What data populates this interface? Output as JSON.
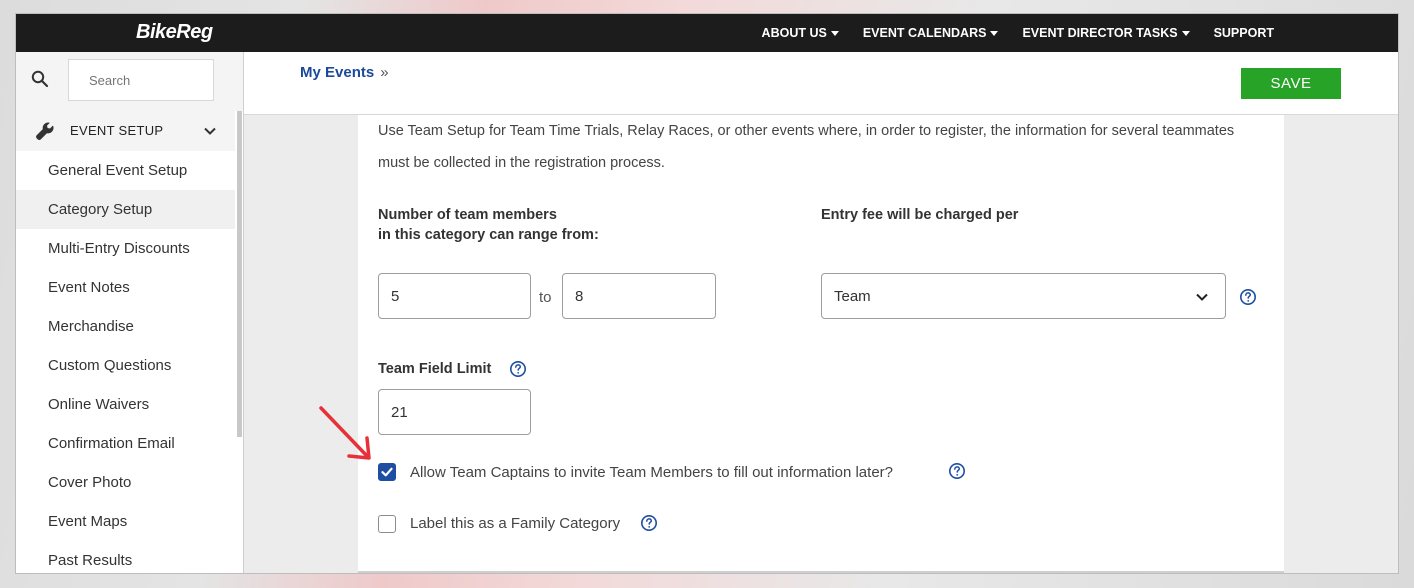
{
  "app": {
    "logo": "BikeReg"
  },
  "nav": [
    {
      "label": "ABOUT US",
      "caret": true
    },
    {
      "label": "EVENT CALENDARS",
      "caret": true
    },
    {
      "label": "EVENT DIRECTOR TASKS",
      "caret": true
    },
    {
      "label": "SUPPORT",
      "caret": false
    }
  ],
  "sidebar": {
    "search_placeholder": "Search",
    "section_label": "EVENT SETUP",
    "items": [
      {
        "label": "General Event Setup"
      },
      {
        "label": "Category Setup"
      },
      {
        "label": "Multi-Entry Discounts"
      },
      {
        "label": "Event Notes"
      },
      {
        "label": "Merchandise"
      },
      {
        "label": "Custom Questions"
      },
      {
        "label": "Online Waivers"
      },
      {
        "label": "Confirmation Email"
      },
      {
        "label": "Cover Photo"
      },
      {
        "label": "Event Maps"
      },
      {
        "label": "Past Results"
      }
    ],
    "active_item": "Category Setup"
  },
  "header": {
    "breadcrumb": "My Events",
    "breadcrumb_sep": "»",
    "save_label": "SAVE"
  },
  "form": {
    "intro": "Use Team Setup for Team Time Trials, Relay Races, or other events where, in order to register, the information for several teammates must be collected in the registration process.",
    "team_members_label_line1": "Number of team members",
    "team_members_label_line2": "in this category can range from:",
    "min_members": "5",
    "to_label": "to",
    "max_members": "8",
    "entry_fee_label": "Entry fee will be charged per",
    "entry_fee_value": "Team",
    "team_field_limit_label": "Team Field Limit",
    "team_field_limit_value": "21",
    "allow_captains_label": "Allow Team Captains to invite Team Members to fill out information later?",
    "allow_captains_checked": true,
    "family_category_label": "Label this as a Family Category",
    "family_category_checked": false
  },
  "colors": {
    "topbar": "#1c1c1c",
    "save_button": "#27a327",
    "link": "#1b4a9b",
    "checkbox": "#1e4ea1",
    "active_indicator": "#8cc63f",
    "annotation_arrow": "#e8303a"
  }
}
